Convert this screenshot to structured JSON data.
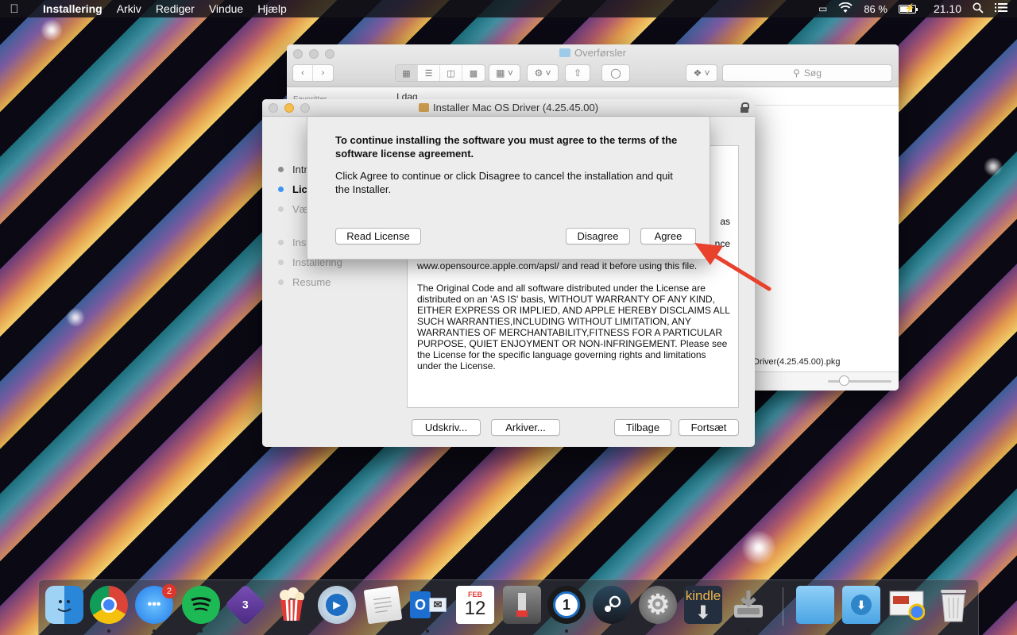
{
  "menubar": {
    "app_name": "Installering",
    "menus": [
      "Arkiv",
      "Rediger",
      "Vindue",
      "Hjælp"
    ],
    "battery_percent": "86 %",
    "battery_level": 0.86,
    "clock": "21.10"
  },
  "finder": {
    "title": "Overførsler",
    "search_placeholder": "Søg",
    "sidebar_section": "Favoritter",
    "group_header": "I dag",
    "file_name": "Driver(4.25.45.00).pkg",
    "icon_size_level": 0.25
  },
  "installer": {
    "title": "Installer Mac OS Driver (4.25.45.00)",
    "steps": [
      {
        "label": "Introduktion",
        "state": "done"
      },
      {
        "label": "Licens",
        "state": "active"
      },
      {
        "label": "Vælg destination",
        "state": "pending"
      },
      {
        "label": "Installeringstype",
        "state": "pending"
      },
      {
        "label": "Installering",
        "state": "pending"
      },
      {
        "label": "Resume",
        "state": "pending"
      }
    ],
    "license_fragments": {
      "frag_as": "as",
      "frag_licence": "nce",
      "url_line": "www.opensource.apple.com/apsl/ and read it before using this file.",
      "paragraph": "The Original Code and all software distributed under the License are distributed on an 'AS IS' basis, WITHOUT WARRANTY OF ANY KIND, EITHER EXPRESS OR IMPLIED, AND APPLE HEREBY DISCLAIMS ALL SUCH WARRANTIES,INCLUDING WITHOUT LIMITATION, ANY WARRANTIES OF MERCHANTABILITY,FITNESS FOR A PARTICULAR PURPOSE, QUIET ENJOYMENT OR NON-INFRINGEMENT. Please see the License for the specific language governing rights and limitations under the License."
    },
    "buttons": {
      "print": "Udskriv...",
      "save": "Arkiver...",
      "back": "Tilbage",
      "continue": "Fortsæt"
    }
  },
  "sheet": {
    "heading": "To continue installing the software you must agree to the terms of the software license agreement.",
    "message": "Click Agree to continue or click Disagree to cancel the installation and quit the Installer.",
    "read_license": "Read License",
    "disagree": "Disagree",
    "agree": "Agree"
  },
  "dock": {
    "messages_badge": "2",
    "calendar_month": "FEB",
    "calendar_day": "12",
    "kindle_label": "kindle",
    "tor_label": "3"
  },
  "colors": {
    "accent_blue": "#3f94f1",
    "annotation_red": "#e8412c"
  }
}
